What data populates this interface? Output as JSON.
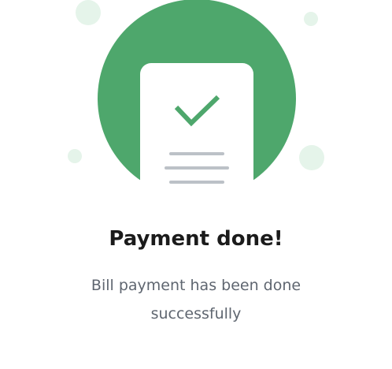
{
  "colors": {
    "accent": "#4ea76c",
    "bubble": "#e5f4ea",
    "lines": "#bcc1c7"
  },
  "title": "Payment done!",
  "message": "Bill payment has been done successfully"
}
